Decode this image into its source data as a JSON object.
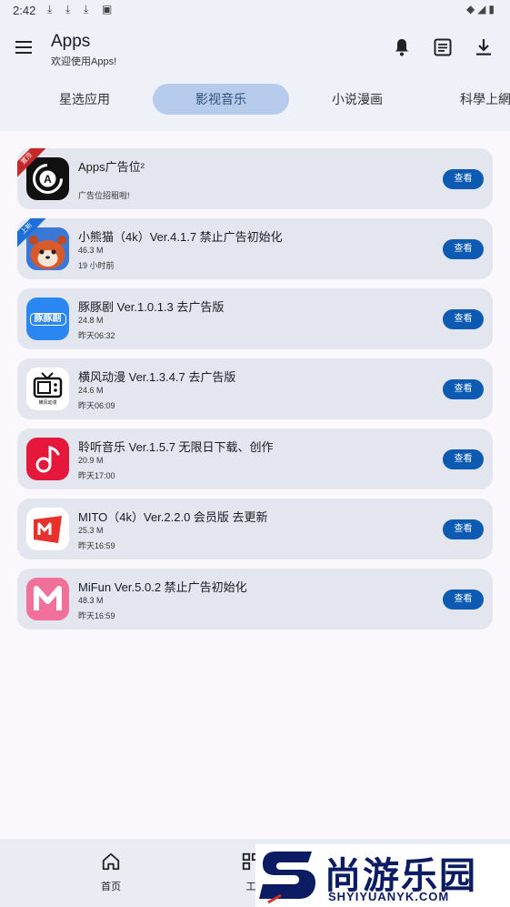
{
  "status_bar": {
    "time": "2:42",
    "dl_glyph": "⤓"
  },
  "header": {
    "title": "Apps",
    "subtitle": "欢迎使用Apps!"
  },
  "tabs": [
    {
      "label": "星选应用"
    },
    {
      "label": "影视音乐",
      "active": true
    },
    {
      "label": "小说漫画"
    },
    {
      "label": "科學上網"
    }
  ],
  "apps": [
    {
      "name": "Apps广告位²",
      "desc": "广告位招租啦!",
      "badge": "置顶",
      "button": "查看"
    },
    {
      "name": "小熊猫（4k）Ver.4.1.7 禁止广告初始化",
      "size": "46.3 M",
      "time": "19 小时前",
      "badge": "上新",
      "button": "查看"
    },
    {
      "name": "豚豚剧 Ver.1.0.1.3 去广告版",
      "size": "24.8 M",
      "time": "昨天06:32",
      "icon_text": "豚豚剧",
      "button": "查看"
    },
    {
      "name": "横风动漫 Ver.1.3.4.7 去广告版",
      "size": "24.6 M",
      "time": "昨天06:09",
      "icon_text": "横风动漫",
      "button": "查看"
    },
    {
      "name": "聆听音乐 Ver.1.5.7 无限日下载、创作",
      "size": "20.9 M",
      "time": "昨天17:00",
      "button": "查看"
    },
    {
      "name": "MITO（4k）Ver.2.2.0 会员版 去更新",
      "size": "25.3 M",
      "time": "昨天16:59",
      "button": "查看"
    },
    {
      "name": "MiFun Ver.5.0.2 禁止广告初始化",
      "size": "48.3 M",
      "time": "昨天16:59",
      "button": "查看"
    }
  ],
  "bottom_nav": [
    {
      "label": "首页",
      "icon": "home-icon"
    },
    {
      "label": "工",
      "icon": "tools-icon"
    }
  ],
  "watermark": {
    "text": "尚游乐园",
    "sub": "SHYIYUANYK.COM"
  },
  "colors": {
    "accent": "#0d5ab3",
    "tab_active": "#b7ccec",
    "card": "#e3e6ee",
    "ribbon_red": "#c62828",
    "ribbon_blue": "#1e6fd9"
  }
}
